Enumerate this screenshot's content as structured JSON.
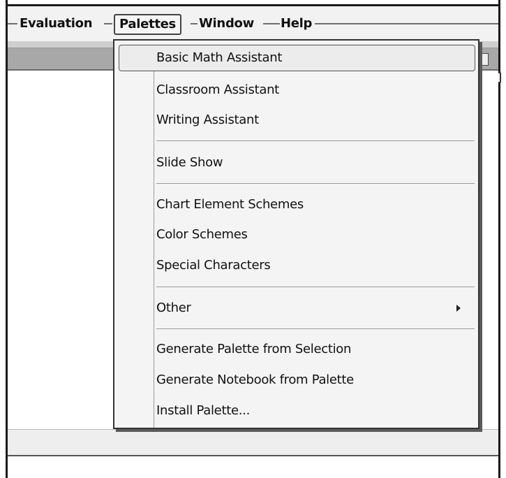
{
  "menubar": {
    "items": [
      "Evaluation",
      "Palettes",
      "Window",
      "Help"
    ],
    "active": "Palettes"
  },
  "palettes_menu": {
    "items": [
      {
        "label": "Basic Math Assistant",
        "highlighted": true
      },
      {
        "label": "Classroom Assistant"
      },
      {
        "label": "Writing Assistant"
      },
      {
        "label": "Slide Show"
      },
      {
        "label": "Chart Element Schemes"
      },
      {
        "label": "Color Schemes"
      },
      {
        "label": "Special Characters"
      },
      {
        "label": "Other",
        "submenu": true
      },
      {
        "label": "Generate Palette from Selection"
      },
      {
        "label": "Generate Notebook from Palette"
      },
      {
        "label": "Install Palette..."
      }
    ],
    "submenu_icon": "triangle-right-icon"
  }
}
